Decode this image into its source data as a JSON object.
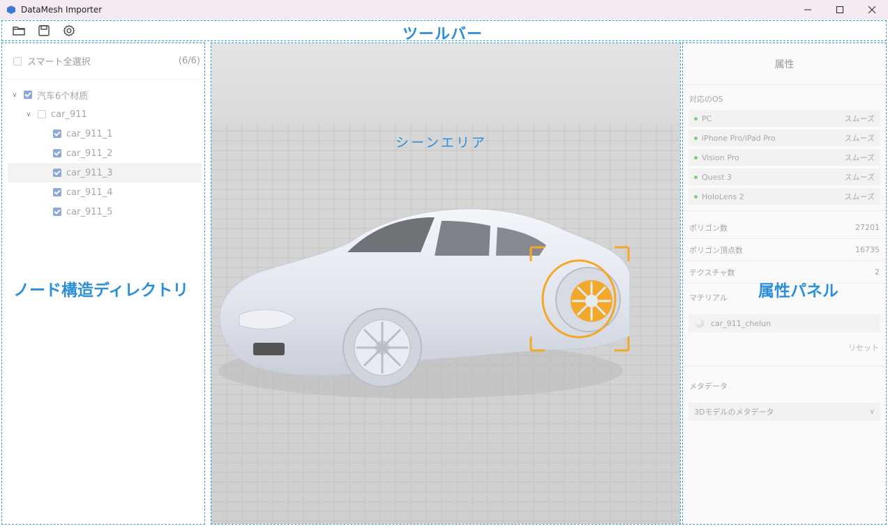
{
  "window": {
    "title": "DataMesh Importer"
  },
  "toolbar": {
    "label": "ツールバー"
  },
  "left_panel": {
    "label": "ノード構造ディレクトリ",
    "select_all_label": "スマート全選択",
    "select_all_count": "(6/6)",
    "tree": [
      {
        "label": "汽车6个材质",
        "level": 0,
        "expanded": true,
        "checked": true
      },
      {
        "label": "car_911",
        "level": 1,
        "expanded": true,
        "checked": false
      },
      {
        "label": "car_911_1",
        "level": 2,
        "checked": true
      },
      {
        "label": "car_911_2",
        "level": 2,
        "checked": true
      },
      {
        "label": "car_911_3",
        "level": 2,
        "checked": true,
        "selected": true
      },
      {
        "label": "car_911_4",
        "level": 2,
        "checked": true
      },
      {
        "label": "car_911_5",
        "level": 2,
        "checked": true
      }
    ]
  },
  "scene": {
    "label": "シーンエリア"
  },
  "right_panel": {
    "title": "属性",
    "label": "属性パネル",
    "os_heading": "対応のOS",
    "os_list": [
      {
        "name": "PC",
        "status": "スムーズ"
      },
      {
        "name": "iPhone Pro/iPad Pro",
        "status": "スムーズ"
      },
      {
        "name": "Vision Pro",
        "status": "スムーズ"
      },
      {
        "name": "Quest 3",
        "status": "スムーズ"
      },
      {
        "name": "HoloLens 2",
        "status": "スムーズ"
      }
    ],
    "stats": [
      {
        "label": "ポリゴン数",
        "value": "27201"
      },
      {
        "label": "ポリゴン頂点数",
        "value": "16735"
      },
      {
        "label": "テクスチャ数",
        "value": "2"
      }
    ],
    "material_heading": "マテリアル",
    "material_name": "car_911_chelun",
    "reset_label": "リセット",
    "meta_heading": "メタデータ",
    "meta_select": "3Dモデルのメタデータ"
  },
  "colors": {
    "annotation": "#2a8fd8",
    "highlight": "#f5a623",
    "os_ok": "#7ed07e"
  }
}
